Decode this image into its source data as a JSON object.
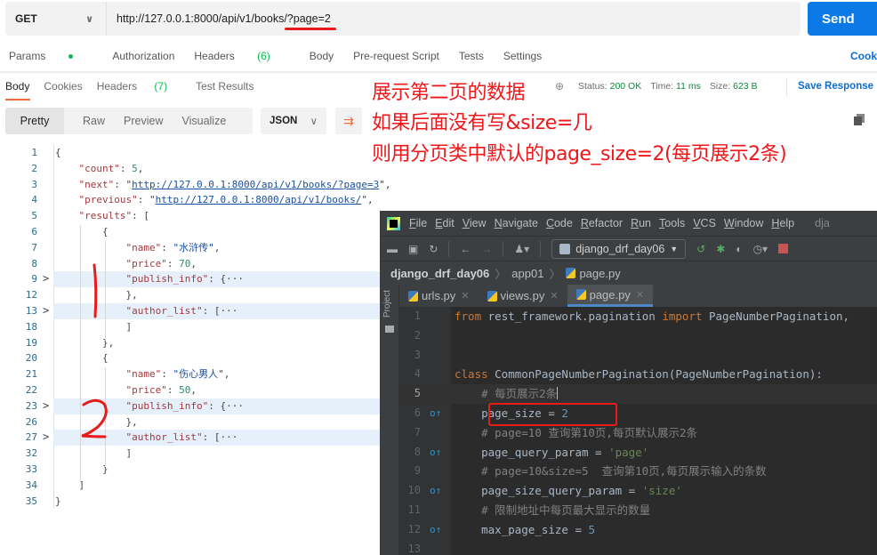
{
  "request": {
    "method": "GET",
    "url": "http://127.0.0.1:8000/api/v1/books/?page=2",
    "send_label": "Send"
  },
  "request_tabs": [
    {
      "label": "Params",
      "badge": ""
    },
    {
      "label": "Authorization",
      "badge": ""
    },
    {
      "label": "Headers",
      "badge": "(6)"
    },
    {
      "label": "Body",
      "badge": ""
    },
    {
      "label": "Pre-request Script",
      "badge": ""
    },
    {
      "label": "Tests",
      "badge": ""
    },
    {
      "label": "Settings",
      "badge": ""
    }
  ],
  "cookies_link": "Cook",
  "response_tabs": {
    "body": "Body",
    "cookies": "Cookies",
    "headers": "Headers",
    "headers_badge": "(7)",
    "test_results": "Test Results"
  },
  "status": {
    "status_label": "Status:",
    "status_value": "200 OK",
    "time_label": "Time:",
    "time_value": "11 ms",
    "size_label": "Size:",
    "size_value": "623 B",
    "save_response": "Save Response"
  },
  "view_modes": [
    "Pretty",
    "Raw",
    "Preview",
    "Visualize"
  ],
  "format": "JSON",
  "annotations": [
    "展示第二页的数据",
    "如果后面没有写&size=几",
    "则用分页类中默认的page_size=2(每页展示2条)"
  ],
  "json_lines": [
    {
      "n": "1",
      "fold": "",
      "hl": false,
      "parts": [
        [
          "p",
          "{"
        ]
      ]
    },
    {
      "n": "2",
      "fold": "",
      "hl": false,
      "parts": [
        [
          "p",
          "    "
        ],
        [
          "k",
          "\"count\""
        ],
        [
          "p",
          ": "
        ],
        [
          "n",
          "5"
        ],
        [
          "p",
          ","
        ]
      ]
    },
    {
      "n": "3",
      "fold": "",
      "hl": false,
      "parts": [
        [
          "p",
          "    "
        ],
        [
          "k",
          "\"next\""
        ],
        [
          "p",
          ": \""
        ],
        [
          "u",
          "http://127.0.0.1:8000/api/v1/books/?page=3"
        ],
        [
          "p",
          "\","
        ]
      ]
    },
    {
      "n": "4",
      "fold": "",
      "hl": false,
      "parts": [
        [
          "p",
          "    "
        ],
        [
          "k",
          "\"previous\""
        ],
        [
          "p",
          ": \""
        ],
        [
          "u",
          "http://127.0.0.1:8000/api/v1/books/"
        ],
        [
          "p",
          "\","
        ]
      ]
    },
    {
      "n": "5",
      "fold": "",
      "hl": false,
      "parts": [
        [
          "p",
          "    "
        ],
        [
          "k",
          "\"results\""
        ],
        [
          "p",
          ": ["
        ]
      ]
    },
    {
      "n": "6",
      "fold": "",
      "hl": false,
      "parts": [
        [
          "p",
          "        {"
        ]
      ]
    },
    {
      "n": "7",
      "fold": "",
      "hl": false,
      "parts": [
        [
          "p",
          "            "
        ],
        [
          "k",
          "\"name\""
        ],
        [
          "p",
          ": "
        ],
        [
          "s",
          "\"水浒传\""
        ],
        [
          "p",
          ","
        ]
      ]
    },
    {
      "n": "8",
      "fold": "",
      "hl": false,
      "parts": [
        [
          "p",
          "            "
        ],
        [
          "k",
          "\"price\""
        ],
        [
          "p",
          ": "
        ],
        [
          "n",
          "70"
        ],
        [
          "p",
          ","
        ]
      ]
    },
    {
      "n": "9",
      "fold": ">",
      "hl": true,
      "parts": [
        [
          "p",
          "            "
        ],
        [
          "k",
          "\"publish_info\""
        ],
        [
          "p",
          ": {···"
        ]
      ]
    },
    {
      "n": "12",
      "fold": "",
      "hl": false,
      "parts": [
        [
          "p",
          "            },"
        ]
      ]
    },
    {
      "n": "13",
      "fold": ">",
      "hl": true,
      "parts": [
        [
          "p",
          "            "
        ],
        [
          "k",
          "\"author_list\""
        ],
        [
          "p",
          ": [···"
        ]
      ]
    },
    {
      "n": "18",
      "fold": "",
      "hl": false,
      "parts": [
        [
          "p",
          "            ]"
        ]
      ]
    },
    {
      "n": "19",
      "fold": "",
      "hl": false,
      "parts": [
        [
          "p",
          "        },"
        ]
      ]
    },
    {
      "n": "20",
      "fold": "",
      "hl": false,
      "parts": [
        [
          "p",
          "        {"
        ]
      ]
    },
    {
      "n": "21",
      "fold": "",
      "hl": false,
      "parts": [
        [
          "p",
          "            "
        ],
        [
          "k",
          "\"name\""
        ],
        [
          "p",
          ": "
        ],
        [
          "s",
          "\"伤心男人\""
        ],
        [
          "p",
          ","
        ]
      ]
    },
    {
      "n": "22",
      "fold": "",
      "hl": false,
      "parts": [
        [
          "p",
          "            "
        ],
        [
          "k",
          "\"price\""
        ],
        [
          "p",
          ": "
        ],
        [
          "n",
          "50"
        ],
        [
          "p",
          ","
        ]
      ]
    },
    {
      "n": "23",
      "fold": ">",
      "hl": true,
      "parts": [
        [
          "p",
          "            "
        ],
        [
          "k",
          "\"publish_info\""
        ],
        [
          "p",
          ": {···"
        ]
      ]
    },
    {
      "n": "26",
      "fold": "",
      "hl": false,
      "parts": [
        [
          "p",
          "            },"
        ]
      ]
    },
    {
      "n": "27",
      "fold": ">",
      "hl": true,
      "parts": [
        [
          "p",
          "            "
        ],
        [
          "k",
          "\"author_list\""
        ],
        [
          "p",
          ": [···"
        ]
      ]
    },
    {
      "n": "32",
      "fold": "",
      "hl": false,
      "parts": [
        [
          "p",
          "            ]"
        ]
      ]
    },
    {
      "n": "33",
      "fold": "",
      "hl": false,
      "parts": [
        [
          "p",
          "        }"
        ]
      ]
    },
    {
      "n": "34",
      "fold": "",
      "hl": false,
      "parts": [
        [
          "p",
          "    ]"
        ]
      ]
    },
    {
      "n": "35",
      "fold": "",
      "hl": false,
      "parts": [
        [
          "p",
          "}"
        ]
      ]
    }
  ],
  "ide": {
    "menu": [
      "File",
      "Edit",
      "View",
      "Navigate",
      "Code",
      "Refactor",
      "Run",
      "Tools",
      "VCS",
      "Window",
      "Help"
    ],
    "project_title": "dja",
    "run_config": "django_drf_day06",
    "breadcrumb": [
      "django_drf_day06",
      "app01",
      "page.py"
    ],
    "side_label": "Project",
    "tabs": [
      {
        "label": "urls.py",
        "active": false
      },
      {
        "label": "views.py",
        "active": false
      },
      {
        "label": "page.py",
        "active": true
      }
    ],
    "code_lines": [
      {
        "n": "1",
        "mark": "",
        "cur": false,
        "parts": [
          [
            "kw",
            "from "
          ],
          [
            "t",
            "rest_framework.pagination "
          ],
          [
            "kw",
            "import "
          ],
          [
            "t",
            "PageNumberPagination,"
          ]
        ]
      },
      {
        "n": "2",
        "mark": "",
        "cur": false,
        "parts": []
      },
      {
        "n": "3",
        "mark": "",
        "cur": false,
        "parts": []
      },
      {
        "n": "4",
        "mark": "",
        "cur": false,
        "parts": [
          [
            "kw",
            "class "
          ],
          [
            "t",
            "CommonPageNumberPagination(PageNumberPagination):"
          ]
        ]
      },
      {
        "n": "5",
        "mark": "",
        "cur": true,
        "parts": [
          [
            "t",
            "    "
          ],
          [
            "cm",
            "# 每页展示2条"
          ]
        ]
      },
      {
        "n": "6",
        "mark": "o↑",
        "cur": false,
        "parts": [
          [
            "t",
            "    page_size = "
          ],
          [
            "nu",
            "2"
          ]
        ]
      },
      {
        "n": "7",
        "mark": "",
        "cur": false,
        "parts": [
          [
            "t",
            "    "
          ],
          [
            "cm",
            "# page=10 查询第10页,每页默认展示2条"
          ]
        ]
      },
      {
        "n": "8",
        "mark": "o↑",
        "cur": false,
        "parts": [
          [
            "t",
            "    page_query_param = "
          ],
          [
            "st",
            "'page'"
          ]
        ]
      },
      {
        "n": "9",
        "mark": "",
        "cur": false,
        "parts": [
          [
            "t",
            "    "
          ],
          [
            "cm",
            "# page=10&size=5  查询第10页,每页展示输入的条数"
          ]
        ]
      },
      {
        "n": "10",
        "mark": "o↑",
        "cur": false,
        "parts": [
          [
            "t",
            "    page_size_query_param = "
          ],
          [
            "st",
            "'size'"
          ]
        ]
      },
      {
        "n": "11",
        "mark": "",
        "cur": false,
        "parts": [
          [
            "t",
            "    "
          ],
          [
            "cm",
            "# 限制地址中每页最大显示的数量"
          ]
        ]
      },
      {
        "n": "12",
        "mark": "o↑",
        "cur": false,
        "parts": [
          [
            "t",
            "    max_page_size = "
          ],
          [
            "nu",
            "5"
          ]
        ]
      },
      {
        "n": "13",
        "mark": "",
        "cur": false,
        "parts": []
      }
    ]
  },
  "colors": {
    "send": "#0c7ae6",
    "annotation": "#f0161a",
    "accent_tab": "#f26b3a",
    "ide_bg": "#2b2b2b"
  }
}
